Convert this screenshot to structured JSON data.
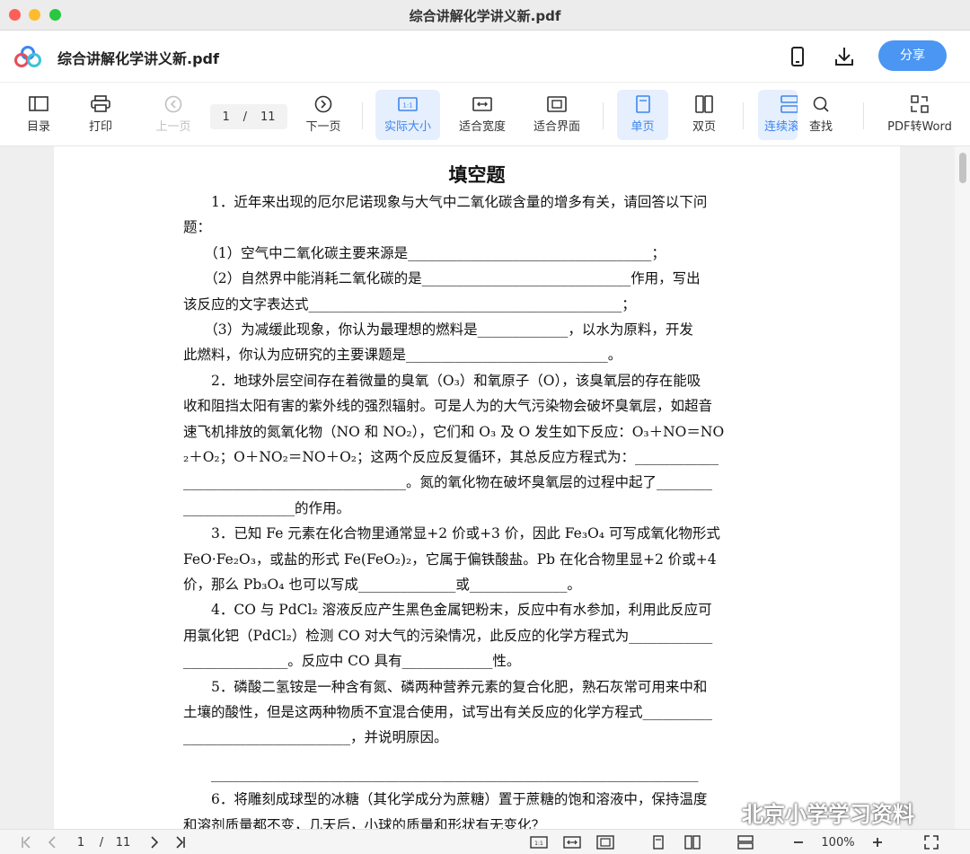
{
  "window": {
    "title": "综合讲解化学讲义新.pdf"
  },
  "header": {
    "file_title": "综合讲解化学讲义新.pdf",
    "share_label": "分享"
  },
  "toolbar": {
    "toc": "目录",
    "print": "打印",
    "prev": "上一页",
    "page_current": "1",
    "page_sep": "/",
    "page_total": "11",
    "next": "下一页",
    "actual_size": "实际大小",
    "fit_width": "适合宽度",
    "fit_page": "适合界面",
    "single": "单页",
    "double": "双页",
    "continuous": "连续滚",
    "find": "查找",
    "pdf_to_word": "PDF转Word"
  },
  "document": {
    "heading": "填空题",
    "lines": [
      "　　1．近年来出现的厄尔尼诺现象与大气中二氧化碳含量的增多有关，请回答以下问",
      "题：",
      "　　（1）空气中二氧化碳主要来源是___________________________________；",
      "　　（2）自然界中能消耗二氧化碳的是______________________________作用，写出",
      "该反应的文字表达式_____________________________________________；",
      "　　（3）为减缓此现象，你认为最理想的燃料是_____________，以水为原料，开发",
      "此燃料，你认为应研究的主要课题是_____________________________。",
      "　　2．地球外层空间存在着微量的臭氧（O₃）和氧原子（O），该臭氧层的存在能吸",
      "收和阻挡太阳有害的紫外线的强烈辐射。可是人为的大气污染物会破坏臭氧层，如超音",
      "速飞机排放的氮氧化物（NO 和 NO₂），它们和 O₃ 及 O 发生如下反应：O₃＋NO＝NO",
      "₂＋O₂；O＋NO₂＝NO＋O₂；这两个反应反复循环，其总反应方程式为：____________",
      "________________________________。氮的氧化物在破坏臭氧层的过程中起了________",
      "________________的作用。",
      "　　3．已知 Fe 元素在化合物里通常显+2 价或+3 价，因此 Fe₃O₄ 可写成氧化物形式",
      "FeO·Fe₂O₃，或盐的形式 Fe(FeO₂)₂，它属于偏铁酸盐。Pb 在化合物里显+2 价或+4",
      "价，那么 Pb₃O₄ 也可以写成______________或______________。",
      "　　4．CO 与 PdCl₂ 溶液反应产生黑色金属钯粉末，反应中有水参加，利用此反应可",
      "用氯化钯（PdCl₂）检测 CO 对大气的污染情况，此反应的化学方程式为____________",
      "_______________。反应中 CO 具有_____________性。",
      "　　5．磷酸二氢铵是一种含有氮、磷两种营养元素的复合化肥，熟石灰常可用来中和",
      "土壤的酸性，但是这两种物质不宜混合使用，试写出有关反应的化学方程式__________",
      "________________________，并说明原因。",
      "　　______________________________________________________________________",
      "　　6．将雕刻成球型的冰糖（其化学成分为蔗糖）置于蔗糖的饱和溶液中，保持温度",
      "和溶剂质量都不变，几天后，小球的质量和形状有无变化？"
    ]
  },
  "watermark": {
    "text": "北京小学学习资料"
  },
  "bottombar": {
    "page_current": "1",
    "page_sep": "/",
    "page_total": "11",
    "zoom": "100%"
  },
  "colors": {
    "accent": "#4b96f3",
    "active_bg": "#e6effd",
    "active_text": "#3d86f0"
  }
}
